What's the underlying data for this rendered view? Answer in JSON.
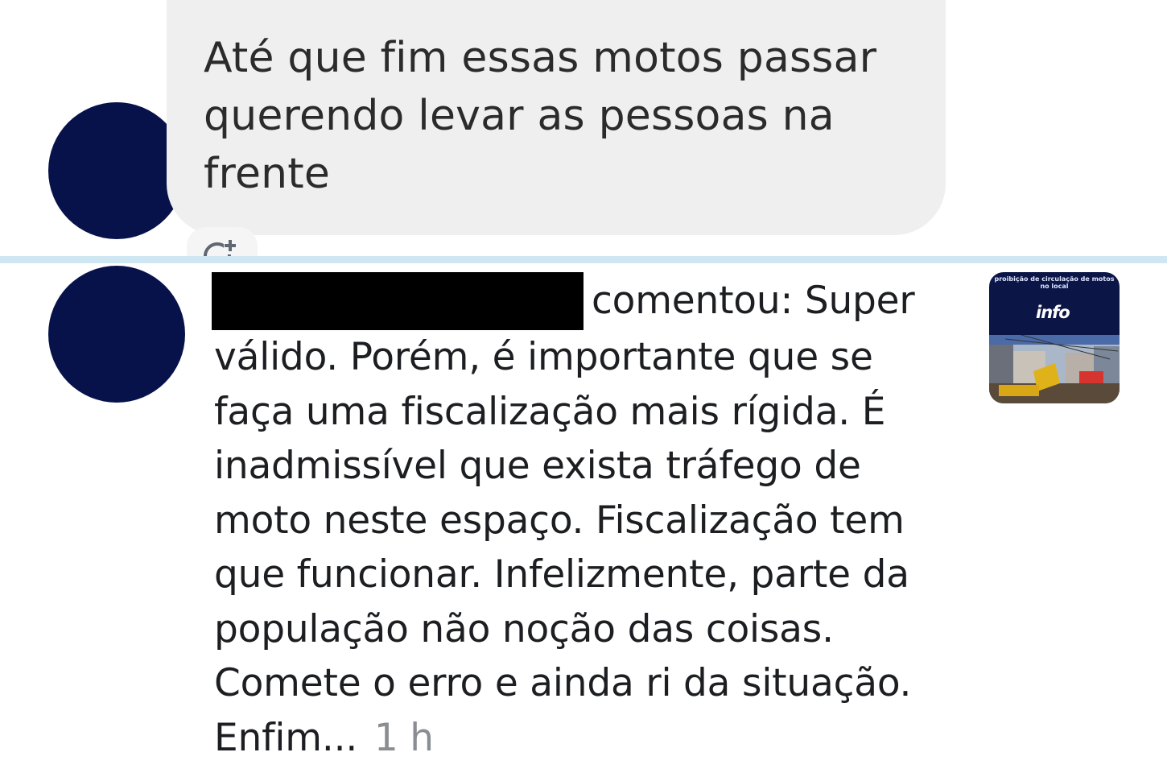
{
  "comment": {
    "text": "Até que fim essas motos passar querendo levar as pessoas na frente",
    "react_icon": "add-reaction-icon"
  },
  "notification": {
    "author": "",
    "verb": "comentou: Super",
    "body": "válido. Porém, é importante que se faça uma fiscalização mais rígida. É inadmissível que exista tráfego de moto neste espaço.  Fiscalização tem que funcionar. Infelizmente, parte da população não noção das coisas. Comete o erro e ainda ri da situação. Enfim...",
    "time": "1 h",
    "thumbnail": {
      "caption": "proibição de circulação de motos no local",
      "logo": "info"
    }
  },
  "colors": {
    "avatar": "#07124a",
    "bubble": "#efefef",
    "divider": "#cfe6f3",
    "time": "#8a8d91",
    "redaction": "#000000"
  }
}
